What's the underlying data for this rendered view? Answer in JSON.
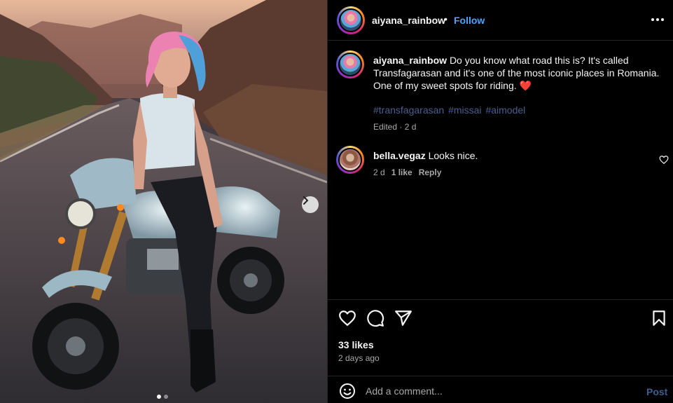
{
  "post": {
    "author": "aiyana_rainbow",
    "separator": "•",
    "follow_label": "Follow",
    "more_icon": "more-horizontal-icon",
    "caption": {
      "text": "Do you know what road this is? It's called Transfagarasan and it's one of the most iconic places in Romania. One of my sweet spots for riding. ",
      "emoji": "❤️",
      "hashtags": [
        "#transfagarasan",
        "#missai",
        "#aimodel"
      ],
      "edited": "Edited · 2 d"
    },
    "comments": [
      {
        "author": "bella.vegaz",
        "text": "Looks nice.",
        "age": "2 d",
        "likes": "1 like",
        "reply_label": "Reply"
      }
    ],
    "likes": "33 likes",
    "posted": "2 days ago",
    "carousel": {
      "total": 2,
      "current": 1
    }
  },
  "composer": {
    "placeholder": "Add a comment...",
    "post_label": "Post"
  },
  "icons": {
    "like": "heart-icon",
    "comment": "comment-bubble-icon",
    "share": "send-icon",
    "save": "bookmark-icon",
    "emoji": "smiley-icon",
    "next": "chevron-right-icon"
  },
  "colors": {
    "background": "#000000",
    "link": "#4da3ff",
    "hashtag": "#4b5f8c",
    "muted": "#a8a8a8",
    "heart": "#e8223c"
  }
}
